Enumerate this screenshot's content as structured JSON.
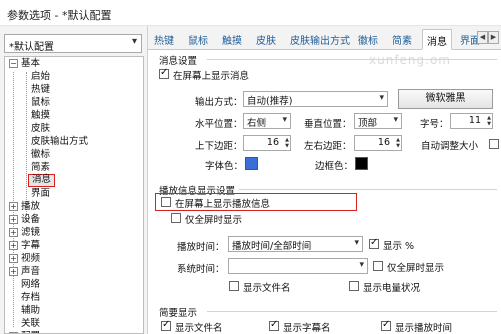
{
  "window": {
    "title": "参数选项 - *默认配置"
  },
  "scheme": {
    "value": "*默认配置"
  },
  "tree": {
    "basic": "基本",
    "basic_children": [
      "启始",
      "热键",
      "鼠标",
      "触摸",
      "皮肤",
      "皮肤输出方式",
      "徽标",
      "简素",
      "消息",
      "界面"
    ],
    "groups": [
      "播放",
      "设备",
      "滤镜",
      "字幕",
      "视频",
      "声音",
      "网络",
      "存档",
      "辅助",
      "关联",
      "配置"
    ]
  },
  "tabs": [
    "热键",
    "鼠标",
    "触摸",
    "皮肤",
    "皮肤输出方式",
    "徽标",
    "简素",
    "消息",
    "界面"
  ],
  "watermark": "xunfeng.om",
  "message_settings": {
    "group_title": "消息设置",
    "show_on_screen": {
      "label": "在屏幕上显示消息",
      "checked": true
    },
    "output_label": "输出方式：",
    "output_value": "自动(推荐)",
    "font_button": "微软雅黑",
    "halign_label": "水平位置：",
    "halign_value": "右侧",
    "valign_label": "垂直位置：",
    "valign_value": "顶部",
    "fontsize_label": "字号：",
    "fontsize_value": "11",
    "margin_tb_label": "上下边距：",
    "margin_tb_value": "16",
    "margin_lr_label": "左右边距：",
    "margin_lr_value": "16",
    "auto_size_label": "自动调整大小",
    "auto_size_checked": false,
    "fontcolor_label": "字体色：",
    "fontcolor": "#3b6fd8",
    "bordercolor_label": "边框色：",
    "bordercolor": "#000000"
  },
  "playback_info": {
    "group_title": "播放信息显示设置",
    "show_info": {
      "label": "在屏幕上显示播放信息",
      "checked": false
    },
    "fullscreen_only": {
      "label": "仅全屏时显示",
      "checked": false
    },
    "time_label": "播放时间：",
    "time_value": "播放时间/全部时间",
    "show_percent": {
      "label": "显示 %",
      "checked": true
    },
    "sys_time_label": "系统时间：",
    "sys_time_value": "",
    "sys_fullscreen_only": {
      "label": "仅全屏时显示",
      "checked": false
    },
    "show_filename": {
      "label": "显示文件名",
      "checked": false
    },
    "show_battery": {
      "label": "显示电量状况",
      "checked": false
    }
  },
  "brief": {
    "group_title": "简要显示",
    "show_filename": {
      "label": "显示文件名",
      "checked": true
    },
    "show_subtitle_name": {
      "label": "显示字幕名",
      "checked": true
    },
    "show_playtime": {
      "label": "显示播放时间",
      "checked": true
    }
  }
}
